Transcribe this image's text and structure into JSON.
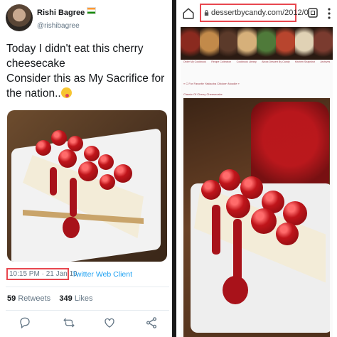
{
  "tweet": {
    "author_name": "Rishi Bagree",
    "handle": "@rishibagree",
    "text_line1": "Today I didn't eat this cherry cheesecake",
    "text_line2": "Consider this as My Sacrifice for the nation..",
    "time": "10:15 PM · 21 Jan 19",
    "client": "Twitter Web Client",
    "retweets_count": "59",
    "retweets_label": "Retweets",
    "likes_count": "349",
    "likes_label": "Likes",
    "icons": [
      "reply-icon",
      "retweet-icon",
      "like-icon",
      "share-icon"
    ]
  },
  "browser": {
    "url": "dessertbycandy.com/2012/0",
    "nav_links": [
      "Order My Cookbook",
      "Recipe Collection",
      "Cookbook Library",
      "About Dessert By Candy",
      "Kitchen Snapshot",
      "Archives"
    ],
    "prev_link": "« C For Favorite Yakisoba Chicken Noodle »",
    "post_title": "Classic Of Cherry Cheesecake",
    "thumb_colors": [
      "#8a2a1f",
      "#c28a4a",
      "#5b3a2a",
      "#d6b07a",
      "#4f7a3a",
      "#b8452e",
      "#e0d2b5",
      "#7a3b2f"
    ]
  },
  "colors": {
    "highlight": "#e8474f",
    "link_blue": "#1da1f2",
    "text_dark": "#14171a",
    "text_muted": "#657786"
  }
}
